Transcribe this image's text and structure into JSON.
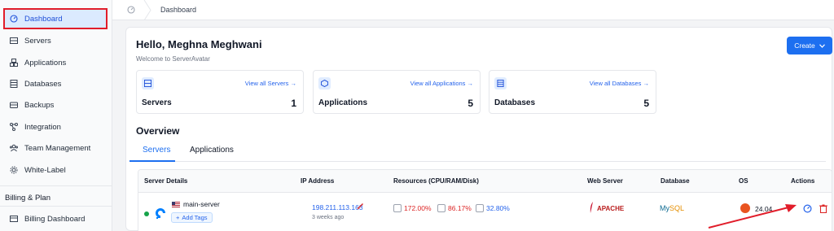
{
  "sidebar": {
    "items": [
      {
        "label": "Dashboard",
        "icon": "dashboard-icon"
      },
      {
        "label": "Servers",
        "icon": "server-icon"
      },
      {
        "label": "Applications",
        "icon": "applications-icon"
      },
      {
        "label": "Databases",
        "icon": "database-icon"
      },
      {
        "label": "Backups",
        "icon": "backup-icon"
      },
      {
        "label": "Integration",
        "icon": "integration-icon"
      },
      {
        "label": "Team Management",
        "icon": "team-icon"
      },
      {
        "label": "White-Label",
        "icon": "white-label-icon"
      }
    ],
    "section_title": "Billing & Plan",
    "billing_item": {
      "label": "Billing Dashboard",
      "icon": "billing-icon"
    }
  },
  "breadcrumb": {
    "current": "Dashboard"
  },
  "header": {
    "greeting": "Hello, Meghna Meghwani",
    "welcome": "Welcome to ServerAvatar",
    "create_label": "Create"
  },
  "stats": [
    {
      "name": "Servers",
      "link": "View all Servers →",
      "count": "1"
    },
    {
      "name": "Applications",
      "link": "View all Applications →",
      "count": "5"
    },
    {
      "name": "Databases",
      "link": "View all Databases →",
      "count": "5"
    }
  ],
  "overview": {
    "title": "Overview",
    "tabs": [
      "Servers",
      "Applications"
    ]
  },
  "table": {
    "columns": [
      "Server Details",
      "IP Address",
      "Resources (CPU/RAM/Disk)",
      "Web Server",
      "Database",
      "OS",
      "Actions"
    ],
    "rows": [
      {
        "name": "main-server",
        "add_tags": "Add Tags",
        "ip": "198.211.113.163",
        "ip_age": "3 weeks ago",
        "cpu": "172.00%",
        "ram": "86.17%",
        "disk": "32.80%",
        "web_server": "APACHE",
        "database_my": "My",
        "database_sql": "SQL",
        "os_version": "24.04"
      }
    ]
  },
  "colors": {
    "accent": "#1d6ff0",
    "highlight": "#e11d2a",
    "danger": "#dc2626",
    "success": "#16a34a"
  }
}
